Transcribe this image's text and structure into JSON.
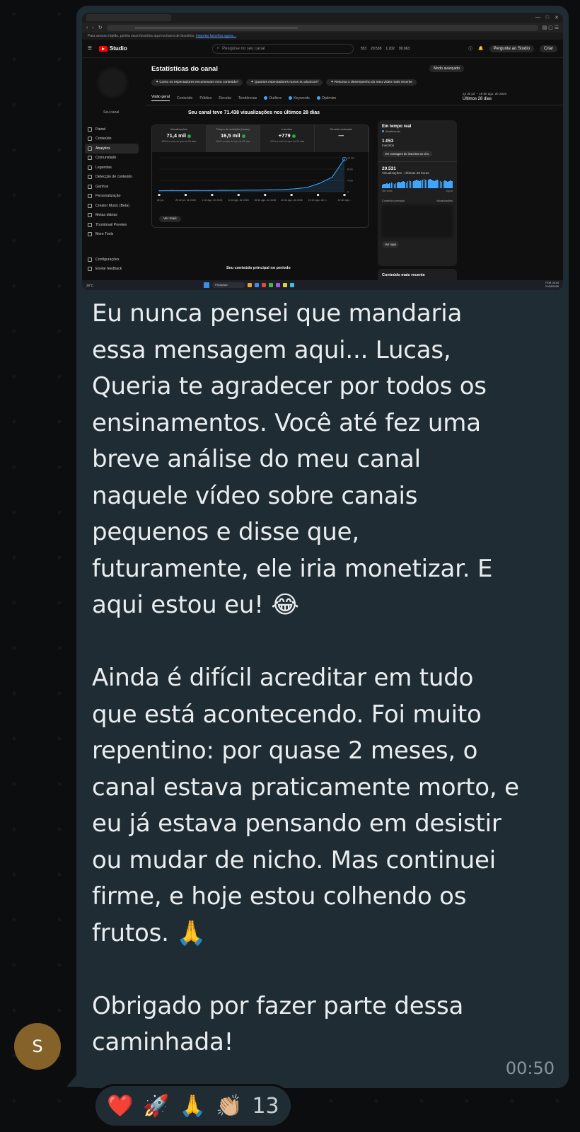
{
  "screenshot": {
    "favorites_hint": "Para acesso rápido, ponha seus favoritos aqui na barra de favoritos.",
    "favorites_link": "Importar favoritos agora...",
    "brand": "Studio",
    "search_placeholder": "Pesquise no seu canal",
    "header_stats": [
      "553",
      "20.538",
      "1.202",
      "99.063"
    ],
    "ask_studio": "Pergunte ao Studio",
    "create_label": "Criar",
    "channel_label": "Seu canal",
    "sidebar": [
      "Painel",
      "Conteúdo",
      "Analytics",
      "Comunidade",
      "Legendas",
      "Detecção de conteúdo",
      "Ganhos",
      "Personalização",
      "Creator Music (Beta)",
      "Metas diárias",
      "Thumbnail Preview",
      "More Tools"
    ],
    "sidebar_bottom": [
      "Configurações",
      "Enviar feedback"
    ],
    "page_title": "Estatísticas do canal",
    "advanced_mode": "Modo avançado",
    "chips": [
      "Como os espectadores encontraram meu conteúdo?",
      "Quantos espectadores novos eu alcancei?",
      "Resuma o desempenho do meu vídeo mais recente"
    ],
    "tabs": [
      "Visão geral",
      "Conteúdo",
      "Público",
      "Receita",
      "Tendências",
      "Outliers",
      "Keywords",
      "Optimize"
    ],
    "period_range": "23 de jul. – 19 de ago. de 2026",
    "period_label": "Últimos 28 dias",
    "summary": "Seu canal teve 71.438 visualizações nos últimos 28 dias",
    "metrics": [
      {
        "label": "Visualizações",
        "value": "71,4 mil",
        "sub": "495% a mais do que há 28 dias"
      },
      {
        "label": "Tempo de exibição (horas)",
        "value": "16,5 mil",
        "sub": "494% a mais do que há 28 dias"
      },
      {
        "label": "Inscritos",
        "value": "+779",
        "sub": "+99% a mais do que há 28 dias"
      },
      {
        "label": "Receita estimada",
        "value": "—",
        "sub": ""
      }
    ],
    "chart_x_ticks": [
      "23 de jul...",
      "28 de jul. de 2026",
      "1 de ago. de 2026",
      "6 de ago. de 2026",
      "10 de ago. de 2026",
      "14 de ago. de 2026",
      "15 de ago. de 2...",
      "19 de ago..."
    ],
    "chart_y_ticks": [
      "12 mil",
      "8 mil",
      "4 mil",
      "0"
    ],
    "see_more": "Ver mais",
    "top_content": "Seu conteúdo principal no período",
    "realtime": {
      "title": "Em tempo real",
      "live": "Atualizando",
      "subs": "1.053",
      "subs_label": "Inscritos",
      "subs_button": "Ver contagem de inscritos ao vivo",
      "views": "20.531",
      "views_label": "Visualizações · Últimas 48 horas",
      "axis_left": "48h atrás",
      "axis_right": "Agora",
      "col_left": "Conteúdo principal",
      "col_right": "Visualizações",
      "see_more": "Ver mais"
    },
    "latest_content": "Conteúdo mais recente",
    "taskbar_search": "Pesquisar",
    "taskbar_weather": "28°C",
    "taskbar_lang": "POR",
    "taskbar_time": "09:43",
    "taskbar_date": "21/08/2026"
  },
  "chart_data": {
    "type": "line",
    "x": [
      "23/07",
      "25/07",
      "27/07",
      "29/07",
      "31/07",
      "02/08",
      "04/08",
      "06/08",
      "08/08",
      "10/08",
      "12/08",
      "14/08",
      "16/08",
      "17/08",
      "18/08",
      "19/08"
    ],
    "series": [
      {
        "values": [
          400,
          500,
          450,
          520,
          480,
          600,
          550,
          650,
          700,
          800,
          900,
          1200,
          1800,
          3500,
          6000,
          13500
        ]
      }
    ],
    "ylim": [
      0,
      14000
    ]
  },
  "message": {
    "text": "Eu nunca pensei que mandaria\nessa mensagem aqui... Lucas,\nQueria te agradecer por todos os\nensinamentos. Você até fez uma\nbreve análise do meu canal\nnaquele vídeo sobre canais\npequenos e disse que,\nfuturamente, ele iria monetizar. E\naqui estou eu! 😂\n\nAinda é difícil acreditar em tudo\nque está acontecendo. Foi muito\nrepentino: por quase 2 meses, o\ncanal estava praticamente morto, e\neu já estava pensando em desistir\nou mudar de nicho. Mas continuei\nfirme, e hoje estou colhendo os\nfrutos. 🙏\n\nObrigado por fazer parte dessa\ncaminhada!",
    "time": "00:50"
  },
  "sender_initial": "S",
  "reactions": {
    "emojis": [
      "❤️",
      "🚀",
      "🙏",
      "👏🏼"
    ],
    "count": "13"
  }
}
